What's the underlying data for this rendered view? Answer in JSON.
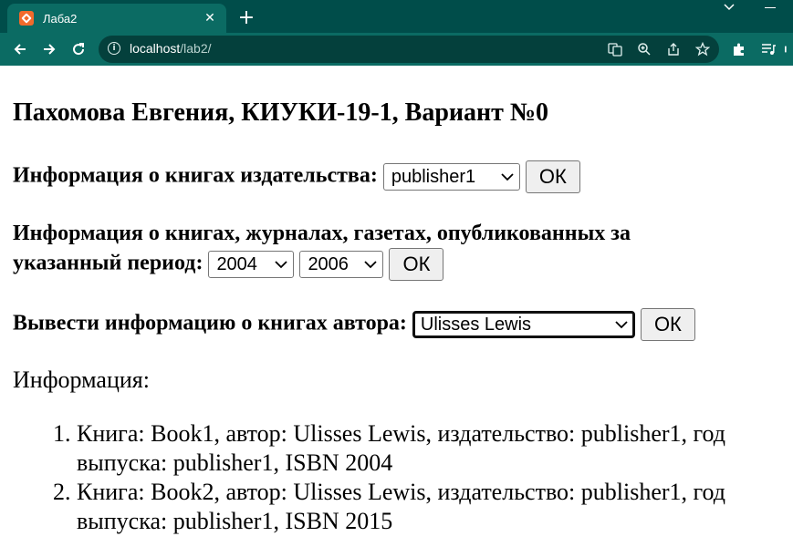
{
  "browser": {
    "tab_title": "Лаба2",
    "url_host": "localhost",
    "url_path": "/lab2/",
    "new_tab_glyph": "+",
    "close_glyph": "✕"
  },
  "page": {
    "title": "Пахомова Евгения, КИУКИ-19-1, Вариант №0",
    "publisher_label": "Информация о книгах издательства:",
    "publisher_value": "publisher1",
    "period_label_line1": "Информация о книгах, журналах, газетах, опубликованных за",
    "period_label_line2": "указанный период:",
    "period_from": "2004",
    "period_to": "2006",
    "author_label": "Вывести информацию о книгах автора:",
    "author_value": "Ulisses Lewis",
    "ok_label": "ОК",
    "info_label": "Информация:",
    "results": [
      "Книга: Book1, автор: Ulisses Lewis, издательство: publisher1, год выпуска: publisher1, ISBN 2004",
      "Книга: Book2, автор: Ulisses Lewis, издательство: publisher1, год выпуска: publisher1, ISBN 2015"
    ]
  },
  "icons": {
    "favicon": "xampp-icon",
    "translate": "translate-icon",
    "zoom": "zoom-icon",
    "share": "share-icon",
    "bookmark": "star-icon",
    "extensions": "puzzle-icon",
    "media": "media-queue-icon"
  },
  "colors": {
    "tabstrip": "#004d4a",
    "toolbar": "#0b6b63",
    "omnibox": "#04403c",
    "button_bg": "#efefef"
  }
}
